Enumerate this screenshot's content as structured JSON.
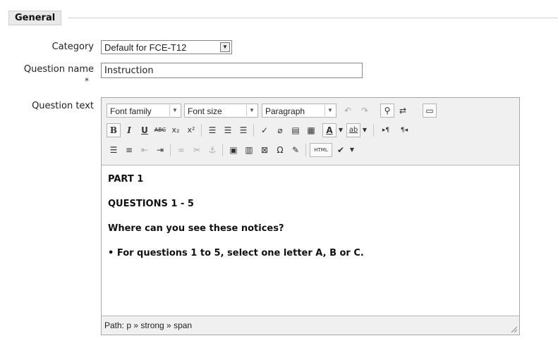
{
  "section": {
    "legend": "General"
  },
  "category": {
    "label": "Category",
    "value": "Default for FCE-T12"
  },
  "question_name": {
    "label": "Question name",
    "required_mark": "*",
    "value": "Instruction"
  },
  "question_text": {
    "label": "Question text",
    "toolbar": {
      "font_family": "Font family",
      "font_size": "Font size",
      "format": "Paragraph",
      "bold": "B",
      "italic": "I",
      "underline": "U",
      "strike": "ABC",
      "subscript": "x₂",
      "superscript": "x²",
      "text_color": "A",
      "highlight": "ab",
      "ltr": "▸¶",
      "rtl": "¶◂",
      "omega": "Ω",
      "html": "HTML"
    },
    "content": {
      "line1": "PART 1",
      "line2": "QUESTIONS 1 - 5",
      "line3": "Where can you see these notices?",
      "line4": "• For questions 1 to 5, select one letter A, B or C."
    },
    "status_path": "Path: p » strong » span"
  }
}
